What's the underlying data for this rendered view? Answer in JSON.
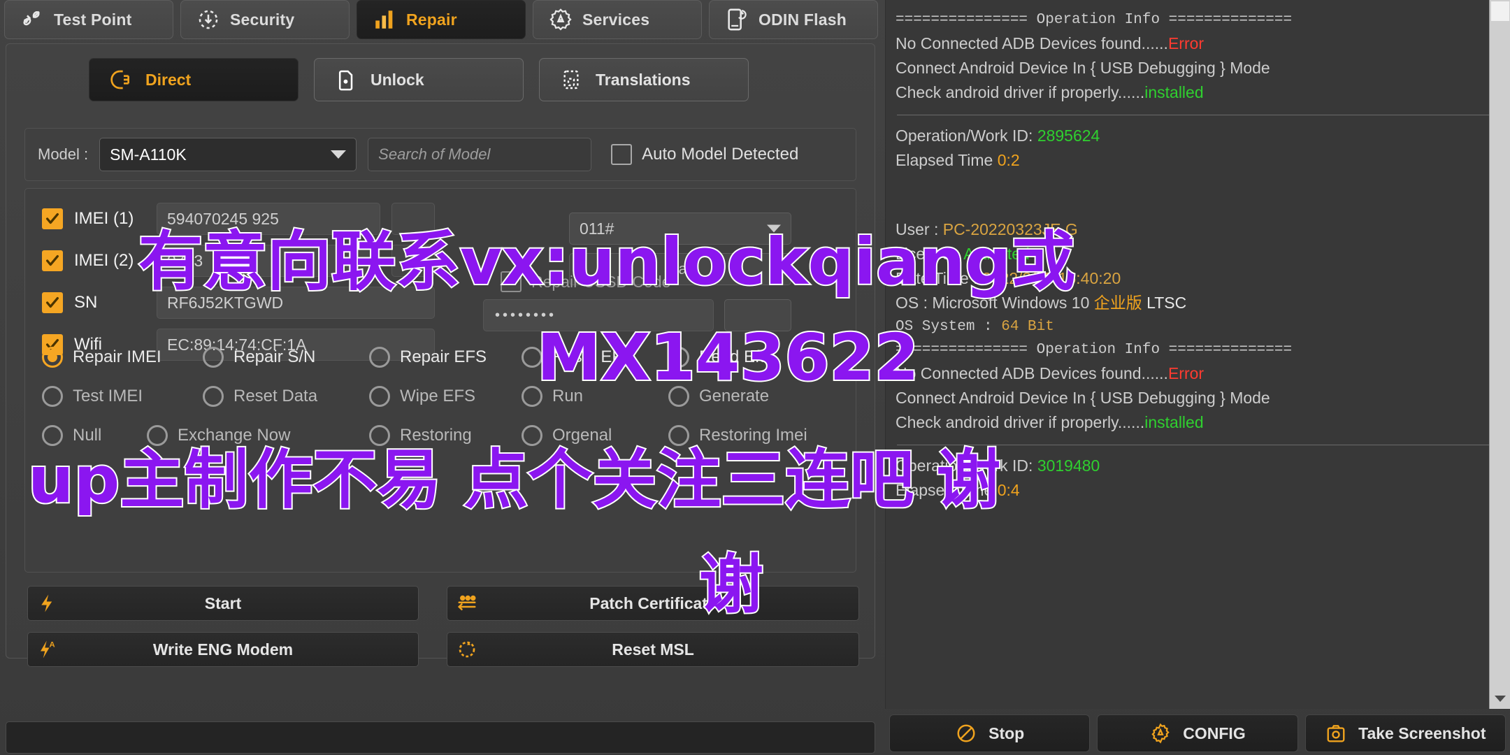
{
  "topbar": {
    "tabs": [
      {
        "label": "Test Point",
        "icon": "testpoint-icon",
        "active": false
      },
      {
        "label": "Security",
        "icon": "security-icon",
        "active": false
      },
      {
        "label": "Repair",
        "icon": "repair-icon",
        "active": true
      },
      {
        "label": "Services",
        "icon": "services-icon",
        "active": false
      },
      {
        "label": "ODIN Flash",
        "icon": "odin-flash-icon",
        "active": false
      }
    ]
  },
  "subtabs": [
    {
      "label": "Direct",
      "icon": "direct-icon",
      "active": true
    },
    {
      "label": "Unlock",
      "icon": "unlock-icon",
      "active": false
    },
    {
      "label": "Translations",
      "icon": "translations-icon",
      "active": false
    }
  ],
  "model_row": {
    "label": "Model :",
    "selected": "SM-A110K",
    "search_placeholder": "Search of Model",
    "auto_detect_label": "Auto Model Detected",
    "auto_detect_checked": false
  },
  "fields": [
    {
      "name": "IMEI (1)",
      "value": "594070245 925",
      "checked": true
    },
    {
      "name": "IMEI (2)",
      "value": "0703",
      "checked": true
    },
    {
      "name": "SN",
      "value": "RF6J52KTGWD",
      "checked": true
    },
    {
      "name": "Wifi",
      "value": "EC:89:14:74:CF:1A",
      "checked": true
    }
  ],
  "ussd": {
    "code_value": "011#",
    "start_label": "Start",
    "repair_label": "Repair USSD Code",
    "repair_checked": false,
    "password_value": "••••••••"
  },
  "radios": [
    {
      "label": "Repair IMEI",
      "selected": true
    },
    {
      "label": "Repair S/N",
      "selected": false
    },
    {
      "label": "Repair EFS",
      "selected": false
    },
    {
      "label": "Reset EFS",
      "selected": false
    },
    {
      "label": "Read Efs",
      "selected": false
    },
    {
      "label": "Test IMEI",
      "selected": false
    },
    {
      "label": "Reset Data",
      "selected": false
    },
    {
      "label": "Wipe EFS",
      "selected": false
    },
    {
      "label": "Run",
      "selected": false
    },
    {
      "label": "Generate",
      "selected": false
    },
    {
      "label": "Null",
      "selected": false
    },
    {
      "label": "Exchange Now",
      "selected": false
    },
    {
      "label": "Restoring",
      "selected": false
    },
    {
      "label": "Orgenal",
      "selected": false
    },
    {
      "label": "Restoring Imei",
      "selected": false
    }
  ],
  "action_buttons": [
    {
      "label": "Start",
      "icon": "bolt-icon"
    },
    {
      "label": "Patch Certificate",
      "icon": "patch-icon"
    },
    {
      "label": "Write ENG Modem",
      "icon": "bolt-a-icon"
    },
    {
      "label": "Reset MSL",
      "icon": "reset-icon"
    }
  ],
  "log": {
    "header": "=============== Operation Info ==============",
    "lines": [
      {
        "text": "No Connected ADB Devices found......",
        "tail": "Error",
        "tail_color": "error"
      },
      {
        "text": "Connect Android Device In { USB Debugging } Mode",
        "tail": "",
        "tail_color": ""
      },
      {
        "text": "Check android driver if properly......",
        "tail": "installed",
        "tail_color": "ok"
      }
    ],
    "block1": {
      "operation_label": "Operation/Work ID:",
      "operation_value": "2895624",
      "elapsed_label": "Elapsed Time",
      "elapsed_value": "0:2"
    },
    "account": {
      "user_label": "User :",
      "user_value": "PC-20220323JE  G",
      "license_label": "License :",
      "license_value": "Activated",
      "date_label": "Date Time :",
      "date_value": "2022/3/25 15:40:20",
      "os_label": "OS : Microsoft Windows 10",
      "os_value": "企业版",
      "os_suffix": "LTSC",
      "system_label": "OS System :",
      "system_value": "64 Bit"
    },
    "block2": {
      "operation_label": "Operation/Work ID:",
      "operation_value": "3019480",
      "elapsed_label": "Elapsed Time",
      "elapsed_value": "0:4"
    }
  },
  "bottom_buttons": [
    {
      "label": "Stop",
      "icon": "stop-icon"
    },
    {
      "label": "CONFIG",
      "icon": "gear-icon"
    },
    {
      "label": "Take Screenshot",
      "icon": "camera-icon"
    }
  ],
  "watermark": {
    "line1": "有意向联系vx:unlockqiang或",
    "line2": "MX143622",
    "line3": "up主制作不易 点个关注三连吧 谢",
    "line4": "谢"
  },
  "colors": {
    "accent": "#f0a31e",
    "ok": "#2fd02f",
    "error": "#ff3b30",
    "watermark": "#8b16f0"
  }
}
